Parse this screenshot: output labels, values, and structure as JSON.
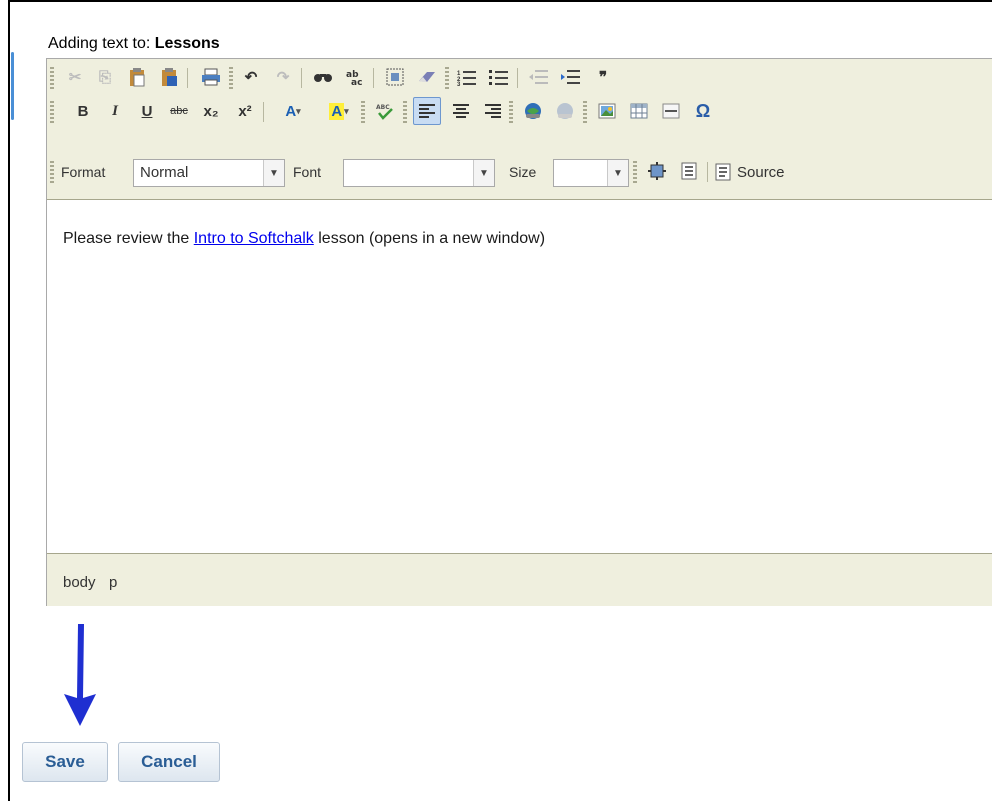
{
  "heading": {
    "prefix": "Adding text to:",
    "target": "Lessons"
  },
  "toolbar": {
    "row1": [
      {
        "name": "cut-icon",
        "glyph": "✂"
      },
      {
        "name": "copy-icon",
        "glyph": "⎘"
      },
      {
        "name": "paste-icon",
        "glyph": "📋"
      },
      {
        "name": "paste-word-icon",
        "glyph": "📋"
      },
      {
        "name": "print-icon",
        "glyph": "🖶"
      },
      {
        "name": "undo-icon",
        "glyph": "↶"
      },
      {
        "name": "redo-icon",
        "glyph": "↷"
      },
      {
        "name": "find-icon",
        "glyph": "🔍"
      },
      {
        "name": "replace-icon",
        "glyph": "⇄"
      },
      {
        "name": "select-all-icon",
        "glyph": "▣"
      },
      {
        "name": "remove-format-icon",
        "glyph": "⌫"
      },
      {
        "name": "numbered-list-icon",
        "glyph": "≡"
      },
      {
        "name": "bulleted-list-icon",
        "glyph": "☰"
      },
      {
        "name": "outdent-icon",
        "glyph": "⇤"
      },
      {
        "name": "indent-icon",
        "glyph": "⇥"
      },
      {
        "name": "blockquote-icon",
        "glyph": "❞"
      }
    ],
    "row2": {
      "bold": "B",
      "italic": "I",
      "underline": "U",
      "strike": "abc",
      "subscript": "x₂",
      "superscript": "x²",
      "text_color": "A",
      "bg_color": "A"
    },
    "format_label": "Format",
    "format_value": "Normal",
    "font_label": "Font",
    "font_value": "",
    "size_label": "Size",
    "size_value": "",
    "source_label": "Source"
  },
  "content": {
    "before_link": "Please review the ",
    "link_text": "Intro to Softchalk",
    "after_link": " lesson (opens in a new window)"
  },
  "path": {
    "items": [
      "body",
      "p"
    ]
  },
  "actions": {
    "save": "Save",
    "cancel": "Cancel"
  },
  "colors": {
    "accent": "#2a5d95",
    "toolbar_bg": "#efefde",
    "arrow": "#1f2fd1",
    "link": "#0000ee"
  }
}
